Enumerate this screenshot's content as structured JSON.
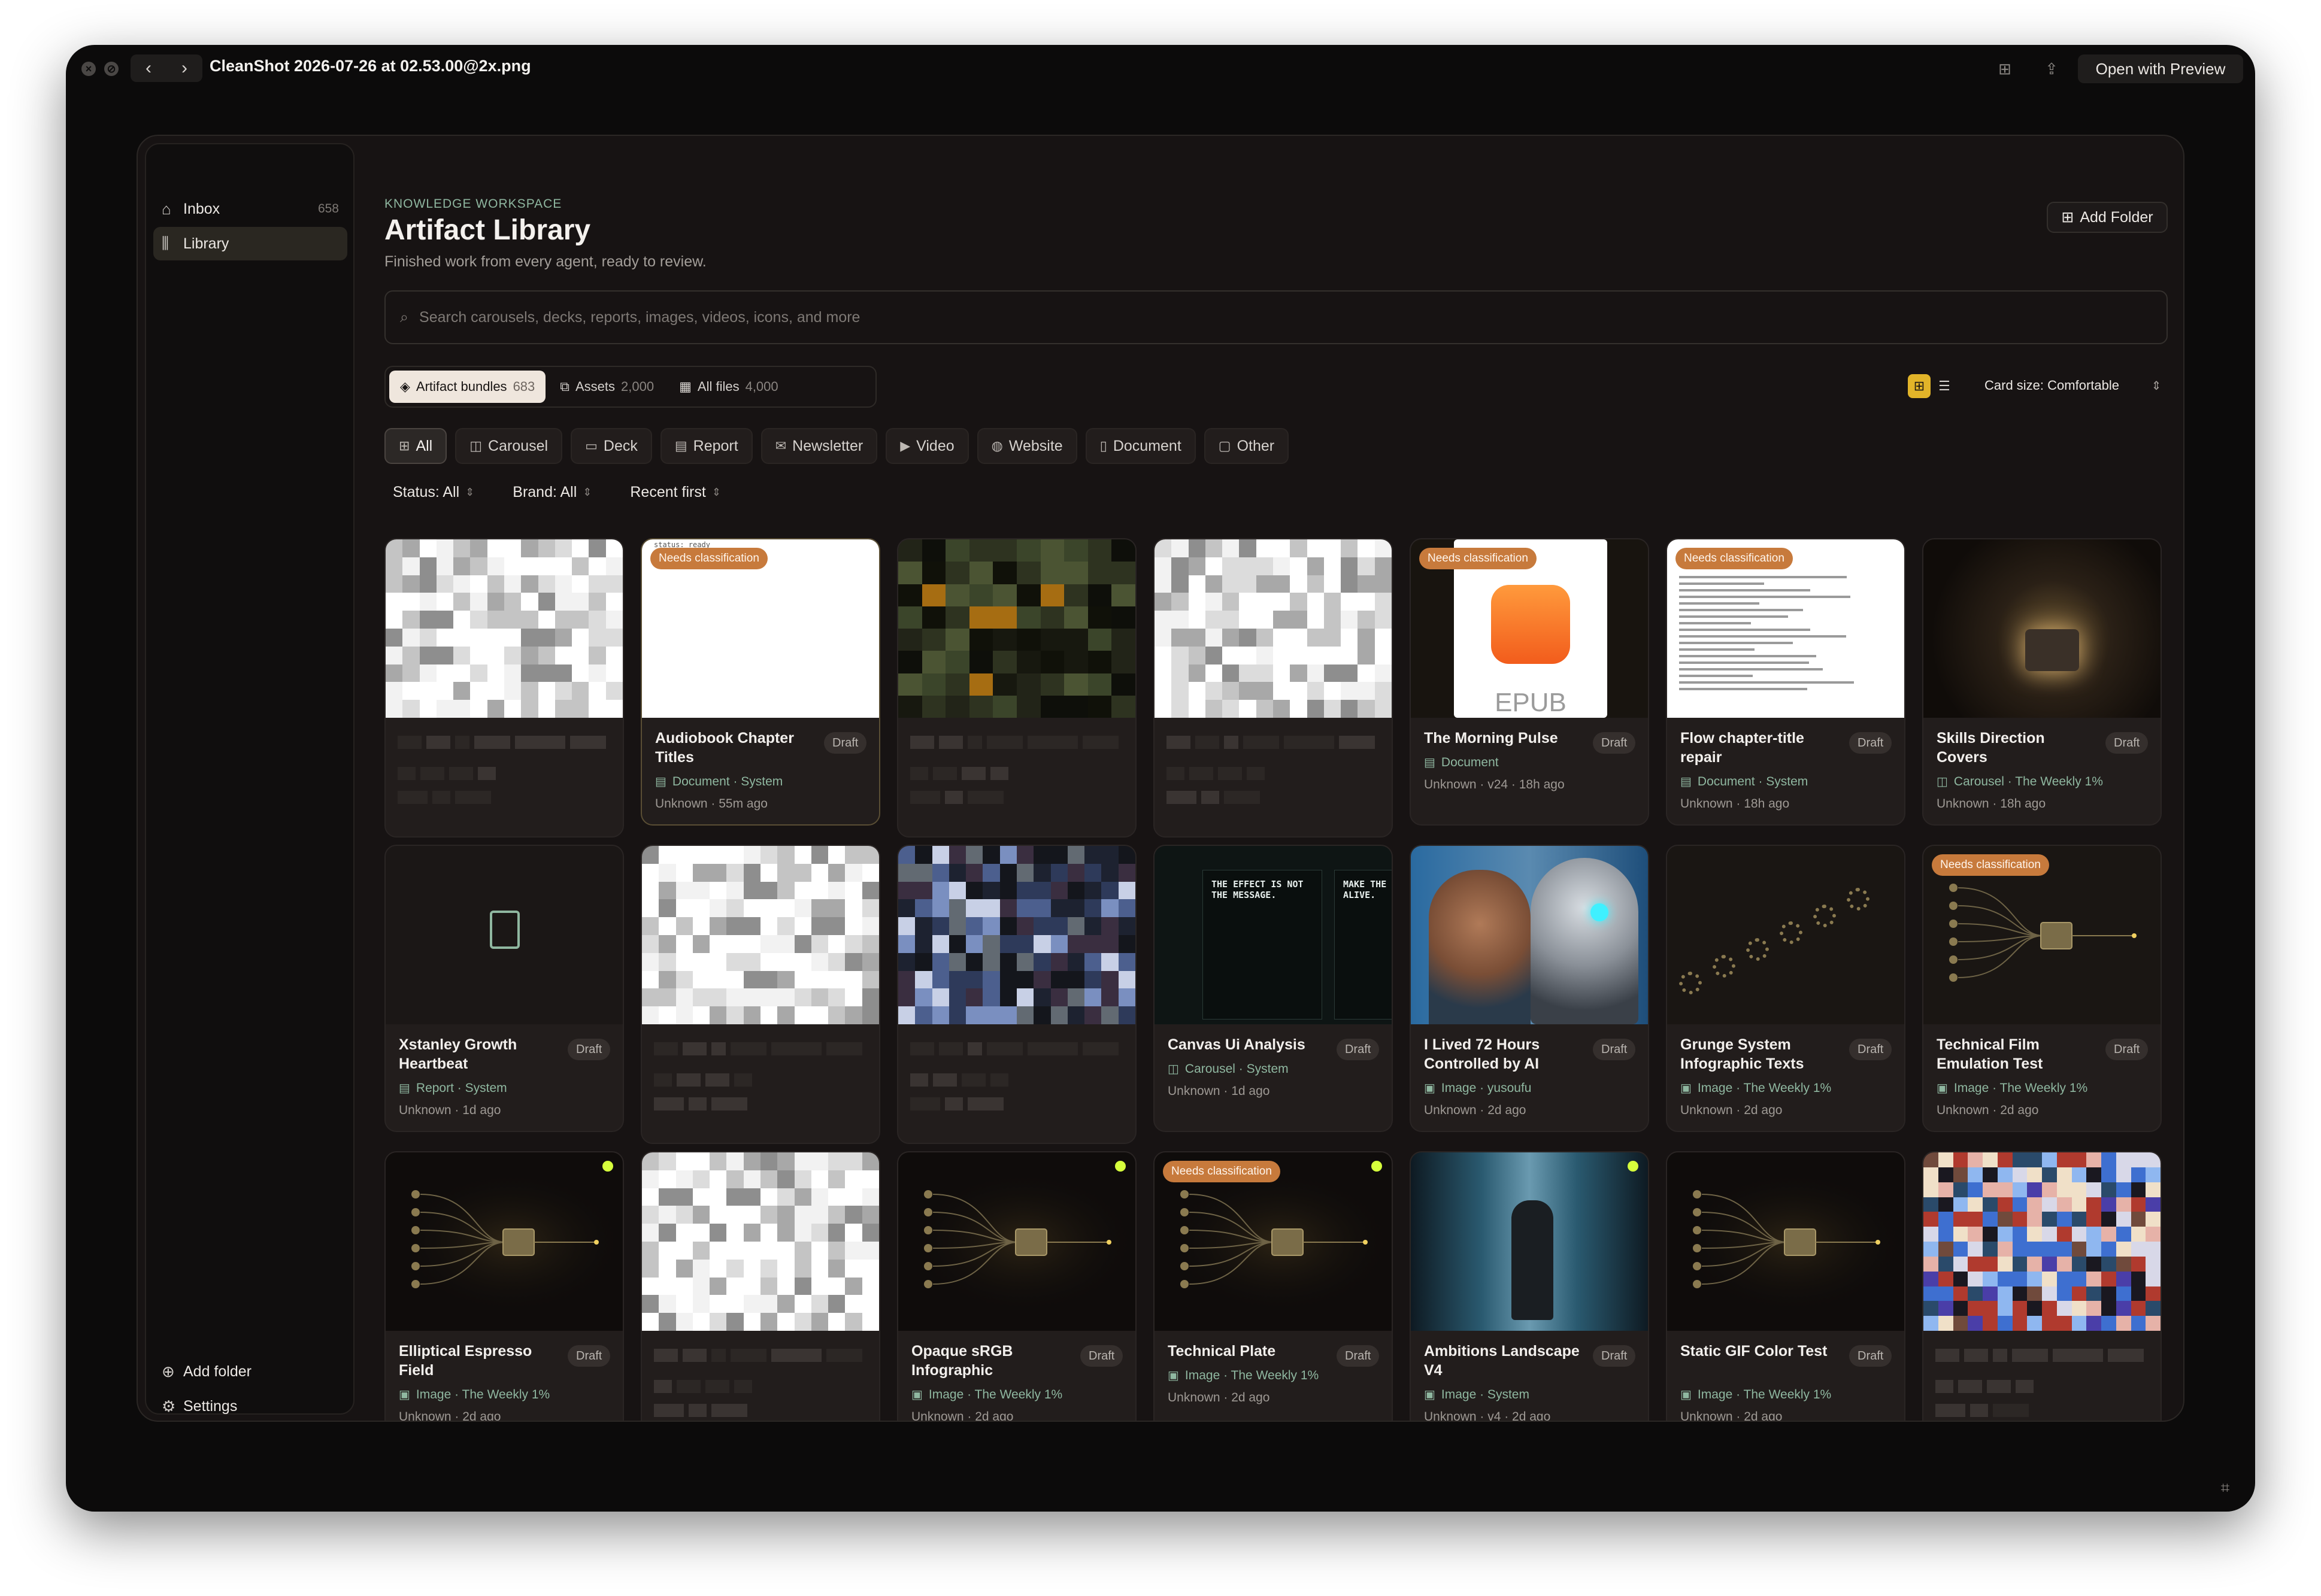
{
  "viewer": {
    "title": "CleanShot 2026-07-26 at 02.53.00@2x.png",
    "open_button": "Open with Preview",
    "icons": [
      "close-circle-icon",
      "block-icon",
      "chevron-left-icon",
      "chevron-right-icon",
      "grid-icon",
      "share-icon",
      "scan-icon"
    ]
  },
  "sidebar": {
    "items": [
      {
        "label": "Inbox",
        "count": "658",
        "icon": "inbox-icon"
      },
      {
        "label": "Library",
        "count": "",
        "icon": "library-icon"
      }
    ],
    "bottom": [
      {
        "label": "Add folder",
        "icon": "folder-plus-icon"
      },
      {
        "label": "Settings",
        "icon": "gear-icon"
      }
    ]
  },
  "header": {
    "eyebrow": "KNOWLEDGE WORKSPACE",
    "title": "Artifact Library",
    "subtitle": "Finished work from every agent, ready to review.",
    "add_folder": "Add Folder"
  },
  "search": {
    "placeholder": "Search carousels, decks, reports, images, videos, icons, and more"
  },
  "segments": [
    {
      "label": "Artifact bundles",
      "count": "683"
    },
    {
      "label": "Assets",
      "count": "2,000"
    },
    {
      "label": "All files",
      "count": "4,000"
    }
  ],
  "view": {
    "card_size": "Card size: Comfortable"
  },
  "chips": [
    "All",
    "Carousel",
    "Deck",
    "Report",
    "Newsletter",
    "Video",
    "Website",
    "Document",
    "Other"
  ],
  "filters": [
    "Status: All",
    "Brand: All",
    "Recent first"
  ],
  "colors": {
    "accent": "#e2b429",
    "badge": "#c77a3c",
    "meta": "#8fb7a0",
    "dot": "#d6ff3c"
  },
  "cards": [
    {
      "title": "",
      "draft": "",
      "meta": "",
      "foot": "",
      "badge": "",
      "thumb": "pixel-light"
    },
    {
      "title": "Audiobook Chapter Titles",
      "draft": "Draft",
      "meta": "Document · System",
      "foot": "Unknown · 55m ago",
      "badge": "Needs classification",
      "thumb": "blank-white",
      "thumb_text": "status: ready"
    },
    {
      "title": "",
      "draft": "",
      "meta": "",
      "foot": "",
      "badge": "",
      "thumb": "pixel-dark"
    },
    {
      "title": "",
      "draft": "",
      "meta": "",
      "foot": "",
      "badge": "",
      "thumb": "pixel-light"
    },
    {
      "title": "The Morning Pulse",
      "draft": "Draft",
      "meta": "Document",
      "foot": "Unknown · v24 · 18h ago",
      "badge": "Needs classification",
      "thumb": "epub",
      "thumb_text": "EPUB"
    },
    {
      "title": "Flow chapter-title repair",
      "draft": "Draft",
      "meta": "Document · System",
      "foot": "Unknown · 18h ago",
      "badge": "Needs classification",
      "thumb": "text-doc"
    },
    {
      "title": "Skills Direction Covers",
      "draft": "Draft",
      "meta": "Carousel · The Weekly 1%",
      "foot": "Unknown · 18h ago",
      "badge": "",
      "thumb": "photo-dark"
    },
    {
      "title": "Xstanley Growth Heartbeat",
      "draft": "Draft",
      "meta": "Report · System",
      "foot": "Unknown · 1d ago",
      "badge": "",
      "thumb": "doc-icon"
    },
    {
      "title": "",
      "draft": "",
      "meta": "",
      "foot": "",
      "badge": "",
      "thumb": "pixel-light"
    },
    {
      "title": "",
      "draft": "",
      "meta": "",
      "foot": "",
      "badge": "",
      "thumb": "pixel-blue"
    },
    {
      "title": "Canvas Ui Analysis",
      "draft": "Draft",
      "meta": "Carousel · System",
      "foot": "Unknown · 1d ago",
      "badge": "",
      "thumb": "slides",
      "thumb_text": "THE EFFECT IS NOT THE MESSAGE.",
      "thumb_text2": "MAKE THE AF FEEL ALIVE."
    },
    {
      "title": "I Lived 72 Hours Controlled by AI",
      "draft": "Draft",
      "meta": "Image · yusoufu",
      "foot": "Unknown · 2d ago",
      "badge": "",
      "thumb": "robot"
    },
    {
      "title": "Grunge System Infographic Texts",
      "draft": "Draft",
      "meta": "Image · The Weekly 1%",
      "foot": "Unknown · 2d ago",
      "badge": "",
      "thumb": "gears"
    },
    {
      "title": "Technical Film Emulation Test",
      "draft": "Draft",
      "meta": "Image · The Weekly 1%",
      "foot": "Unknown · 2d ago",
      "badge": "Needs classification",
      "thumb": "circuit-light"
    },
    {
      "title": "Elliptical Espresso Field",
      "draft": "Draft",
      "meta": "Image · The Weekly 1%",
      "foot": "Unknown · 2d ago",
      "badge": "",
      "thumb": "circuit",
      "dot": true
    },
    {
      "title": "",
      "draft": "",
      "meta": "",
      "foot": "",
      "badge": "",
      "thumb": "pixel-light"
    },
    {
      "title": "Opaque sRGB Infographic",
      "draft": "Draft",
      "meta": "Image · The Weekly 1%",
      "foot": "Unknown · 2d ago",
      "badge": "",
      "thumb": "circuit",
      "dot": true
    },
    {
      "title": "Technical Plate",
      "draft": "Draft",
      "meta": "Image · The Weekly 1%",
      "foot": "Unknown · 2d ago",
      "badge": "Needs classification",
      "thumb": "circuit",
      "dot": true
    },
    {
      "title": "Ambitions Landscape V4",
      "draft": "Draft",
      "meta": "Image · System",
      "foot": "Unknown · v4 · 2d ago",
      "badge": "",
      "thumb": "elevator",
      "dot": true
    },
    {
      "title": "Static GIF Color Test",
      "draft": "Draft",
      "meta": "Image · The Weekly 1%",
      "foot": "Unknown · 2d ago",
      "badge": "",
      "thumb": "circuit"
    },
    {
      "title": "",
      "draft": "",
      "meta": "",
      "foot": "",
      "badge": "",
      "thumb": "pixel-color"
    }
  ]
}
